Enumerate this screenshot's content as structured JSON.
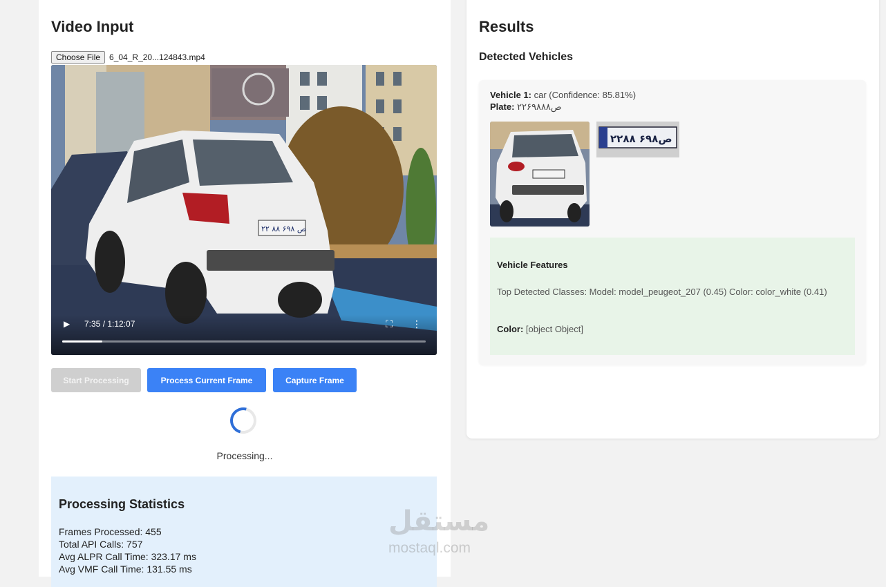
{
  "video_panel": {
    "title": "Video Input",
    "file_button": "Choose File",
    "file_name": "6_04_R_20...124843.mp4",
    "video": {
      "time": "7:35 / 1:12:07",
      "progress": 0.11,
      "plate_text": "۲۲ ص ۶۹۸ ۸۸"
    },
    "buttons": {
      "start": "Start Processing",
      "process_current": "Process Current Frame",
      "capture": "Capture Frame"
    },
    "status": "Processing...",
    "stats": {
      "title": "Processing Statistics",
      "frames": "Frames Processed: 455",
      "api_calls": "Total API Calls: 757",
      "alpr_time": "Avg ALPR Call Time: 323.17 ms",
      "vmf_time": "Avg VMF Call Time: 131.55 ms"
    }
  },
  "results_panel": {
    "title": "Results",
    "detected_title": "Detected Vehicles",
    "vehicle": {
      "label": "Vehicle 1:",
      "description": "car (Confidence: 85.81%)",
      "plate_label": "Plate:",
      "plate_value": "۲۲ص۶۹۸۸۸",
      "plate_image_text": "۲۲ص۶۹۸ ۸۸",
      "features": {
        "title": "Vehicle Features",
        "top_classes": "Top Detected Classes: Model: model_peugeot_207 (0.45) Color: color_white (0.41)",
        "color_label": "Color:",
        "color_value": "[object Object]"
      }
    }
  },
  "watermark": {
    "arabic": "مستقل",
    "latin": "mostaql.com"
  },
  "colors": {
    "primary": "#3b82f6",
    "disabled": "#cfcfcf",
    "stats_bg": "#e3f0fc",
    "features_bg": "#e8f4e8"
  }
}
